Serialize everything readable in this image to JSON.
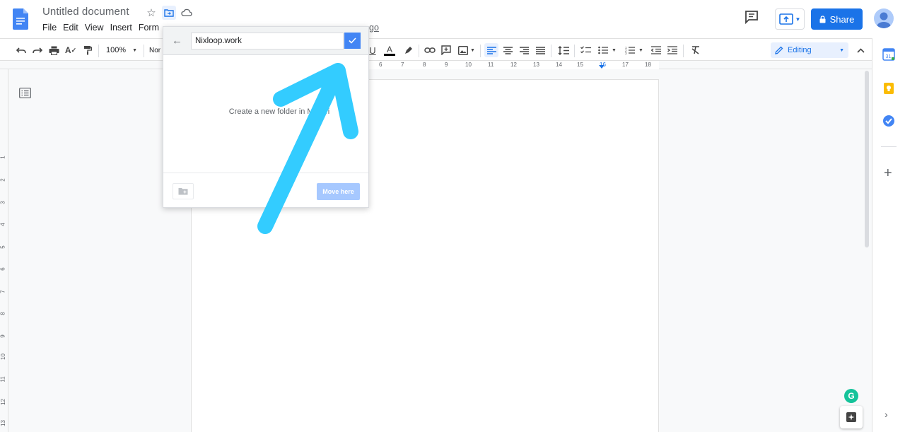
{
  "app": {
    "doc_title": "Untitled document",
    "menus": [
      "File",
      "Edit",
      "View",
      "Insert",
      "Form"
    ],
    "menu_tail_text": "go",
    "share_label": "Share"
  },
  "toolbar": {
    "zoom": "100%",
    "style_partial": "Nor",
    "mode_label": "Editing"
  },
  "ruler": {
    "h_numbers": [
      "6",
      "7",
      "8",
      "9",
      "10",
      "11",
      "12",
      "13",
      "14",
      "15",
      "16",
      "17",
      "18"
    ],
    "v_numbers": [
      "1",
      "2",
      "3",
      "4",
      "5",
      "6",
      "7",
      "8",
      "9",
      "10",
      "11",
      "12",
      "13"
    ]
  },
  "move_dialog": {
    "folder_name_value": "Nixloop.work",
    "message": "Create a new folder in My Dri",
    "move_here_label": "Move here"
  },
  "colors": {
    "brand_blue": "#1a73e8",
    "confirm_blue": "#4285f4",
    "disabled_blue": "#a6c8ff",
    "annotation_arrow": "#33ccff",
    "grammarly_green": "#15c39a"
  }
}
